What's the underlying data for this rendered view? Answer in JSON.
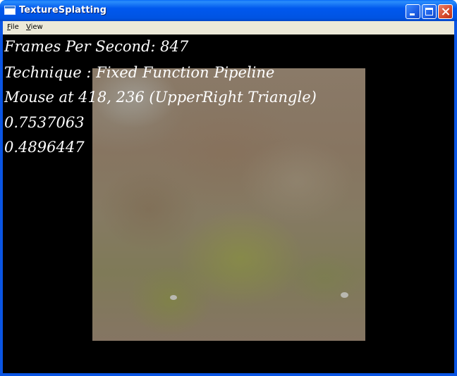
{
  "window": {
    "title": "TextureSplatting",
    "icon": "app-window-icon",
    "controls": [
      "minimize-icon",
      "maximize-icon",
      "close-icon"
    ]
  },
  "menu": {
    "file": {
      "accel": "F",
      "rest": "ile"
    },
    "view": {
      "accel": "V",
      "rest": "iew"
    }
  },
  "overlay": {
    "fps": "Frames Per Second: 847",
    "technique": "Technique : Fixed Function Pipeline",
    "mouse": "Mouse at 418, 236 (UpperRight Triangle)",
    "value1": "0.7537063",
    "value2": "0.4896447"
  },
  "colors": {
    "titlebar": "#0054e3",
    "menubar": "#ece9d8",
    "viewport": "#000000",
    "overlay_text": "#ffffff",
    "close_button": "#d6492b"
  }
}
